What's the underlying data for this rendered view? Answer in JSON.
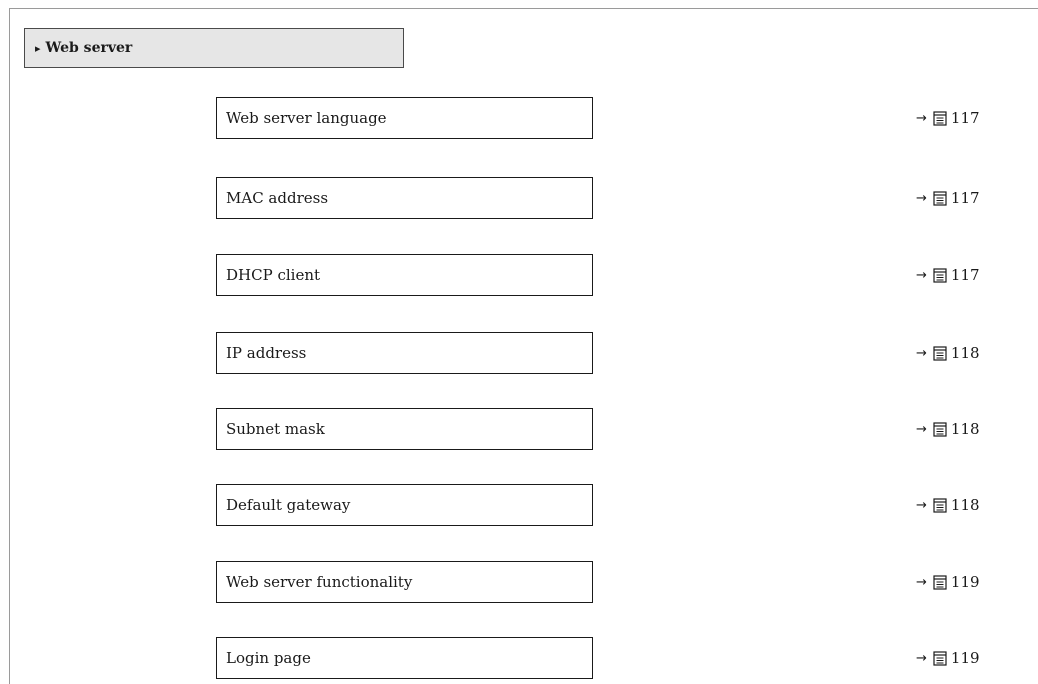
{
  "header": {
    "marker": "▸",
    "label": "Web server"
  },
  "parameters": [
    {
      "label": "Web server language",
      "arrow": "→",
      "page": "117"
    },
    {
      "label": "MAC address",
      "arrow": "→",
      "page": "117"
    },
    {
      "label": "DHCP client",
      "arrow": "→",
      "page": "117"
    },
    {
      "label": "IP address",
      "arrow": "→",
      "page": "118"
    },
    {
      "label": "Subnet mask",
      "arrow": "→",
      "page": "118"
    },
    {
      "label": "Default gateway",
      "arrow": "→",
      "page": "118"
    },
    {
      "label": "Web server functionality",
      "arrow": "→",
      "page": "119"
    },
    {
      "label": "Login page",
      "arrow": "→",
      "page": "119"
    }
  ],
  "icons": {
    "page_reference": "document-page-icon"
  },
  "colors": {
    "header_background": "#e6e6e6",
    "border": "#1a1a1a",
    "frame_line": "#9a9a9a"
  }
}
